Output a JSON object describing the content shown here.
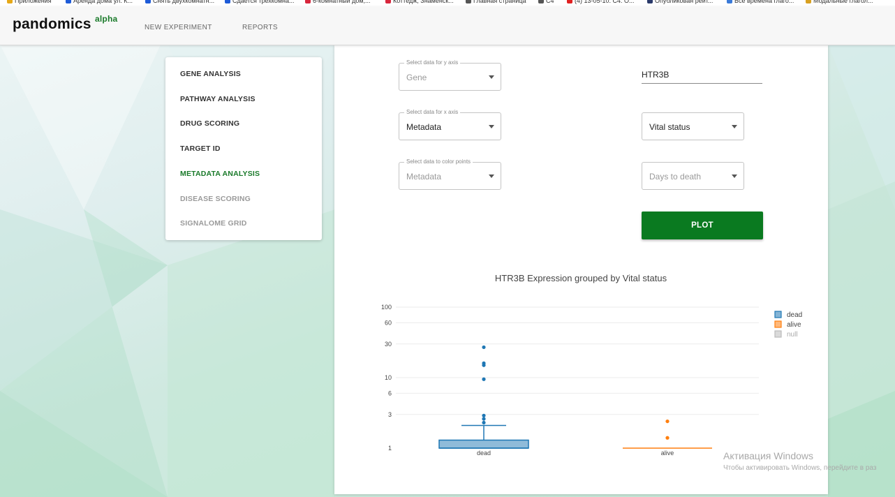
{
  "bookmarks": [
    {
      "label": "Приложения",
      "color": "#e6a817"
    },
    {
      "label": "Аренда дома ул. К...",
      "color": "#1e5bd8"
    },
    {
      "label": "Снять двухкомнатн...",
      "color": "#1e5bd8"
    },
    {
      "label": "Сдается трехкомна...",
      "color": "#1e5bd8"
    },
    {
      "label": "6-комнатный дом,...",
      "color": "#d8263c"
    },
    {
      "label": "Коттедж, Знаменск...",
      "color": "#d8263c"
    },
    {
      "label": "Главная страница",
      "color": "#555555"
    },
    {
      "label": "C4",
      "color": "#555555"
    },
    {
      "label": "(4) 13-05-10. C4. O...",
      "color": "#e02020"
    },
    {
      "label": "Опубликован рейт...",
      "color": "#2a3a6a"
    },
    {
      "label": "Все времена глаго...",
      "color": "#3a7ad8"
    },
    {
      "label": "Модальные глагол...",
      "color": "#d8a020"
    }
  ],
  "header": {
    "logo": "pandomics",
    "logo_badge": "alpha",
    "nav": [
      "NEW EXPERIMENT",
      "REPORTS"
    ]
  },
  "sidebar": {
    "items": [
      {
        "label": "GENE ANALYSIS",
        "state": "normal"
      },
      {
        "label": "PATHWAY ANALYSIS",
        "state": "normal"
      },
      {
        "label": "DRUG SCORING",
        "state": "normal"
      },
      {
        "label": "TARGET ID",
        "state": "normal"
      },
      {
        "label": "METADATA ANALYSIS",
        "state": "active"
      },
      {
        "label": "DISEASE SCORING",
        "state": "disabled"
      },
      {
        "label": "SIGNALOME GRID",
        "state": "disabled"
      }
    ]
  },
  "form": {
    "y_axis": {
      "label": "Select data for y axis",
      "value": "Gene"
    },
    "x_axis": {
      "label": "Select data for x axis",
      "value": "Metadata"
    },
    "color": {
      "label": "Select data to color points",
      "value": "Metadata"
    },
    "gene_value": "HTR3B",
    "x_meta_value": "Vital status",
    "color_meta_value": "Days to death",
    "plot_label": "PLOT"
  },
  "chart_data": {
    "type": "box",
    "title": "HTR3B Expression grouped by Vital status",
    "yscale": "log",
    "ylim": [
      1,
      100
    ],
    "yticks": [
      1,
      3,
      6,
      10,
      30,
      60,
      100
    ],
    "categories": [
      "dead",
      "alive"
    ],
    "series": [
      {
        "name": "dead",
        "color": "#1f77b4",
        "q1": 1.0,
        "median": 1.0,
        "q3": 1.3,
        "lower_whisker": 1.0,
        "upper_whisker": 2.1,
        "outliers": [
          2.3,
          2.6,
          2.9,
          9.5,
          15,
          16,
          27
        ]
      },
      {
        "name": "alive",
        "color": "#ff7f0e",
        "q1": 1.0,
        "median": 1.0,
        "q3": 1.0,
        "lower_whisker": 1.0,
        "upper_whisker": 1.0,
        "outliers": [
          1.4,
          2.4
        ]
      },
      {
        "name": "null",
        "color": "#bbbbbb",
        "values": []
      }
    ],
    "legend": [
      "dead",
      "alive",
      "null"
    ],
    "legend_position": "top-right",
    "grid": true
  },
  "watermark": {
    "line1": "Активация Windows",
    "line2": "Чтобы активировать Windows, перейдите в раз"
  }
}
